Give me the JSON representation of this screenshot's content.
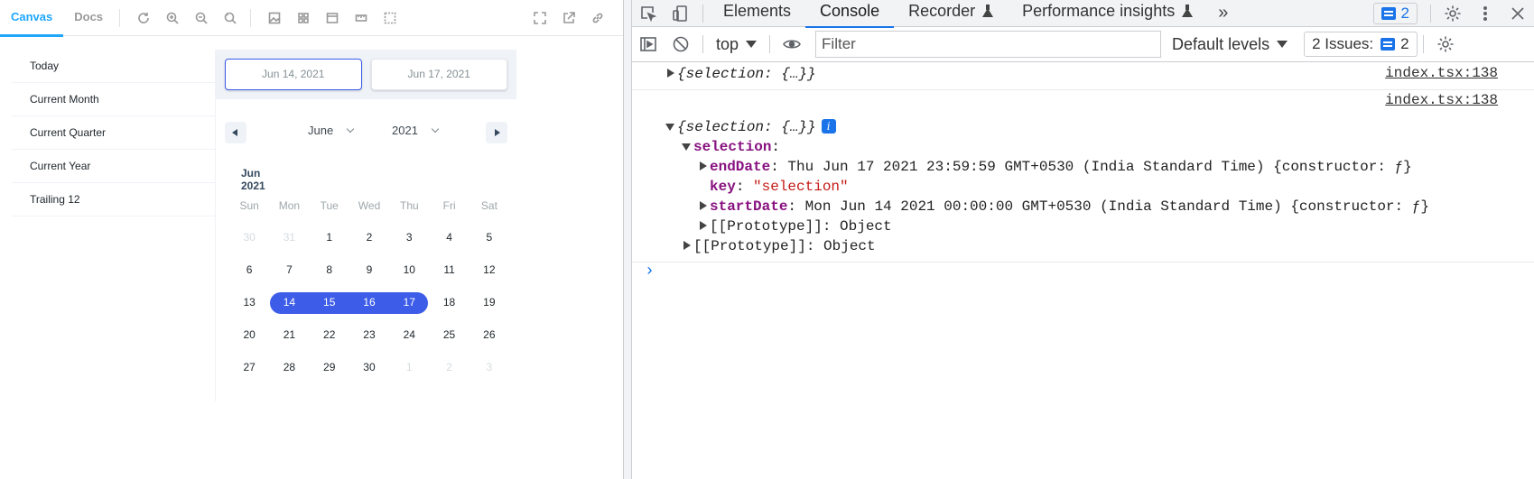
{
  "storybook": {
    "tabs": [
      "Canvas",
      "Docs"
    ],
    "active_tab": "Canvas"
  },
  "date_range_picker": {
    "static_ranges": [
      "Today",
      "Current Month",
      "Current Quarter",
      "Current Year",
      "Trailing 12"
    ],
    "start_date": "Jun 14, 2021",
    "end_date": "Jun 17, 2021",
    "month_picker": "June",
    "year_picker": "2021",
    "month_label": "Jun 2021",
    "weekdays": [
      "Sun",
      "Mon",
      "Tue",
      "Wed",
      "Thu",
      "Fri",
      "Sat"
    ],
    "weeks": [
      [
        "30",
        "31",
        "1",
        "2",
        "3",
        "4",
        "5"
      ],
      [
        "6",
        "7",
        "8",
        "9",
        "10",
        "11",
        "12"
      ],
      [
        "13",
        "14",
        "15",
        "16",
        "17",
        "18",
        "19"
      ],
      [
        "20",
        "21",
        "22",
        "23",
        "24",
        "25",
        "26"
      ],
      [
        "27",
        "28",
        "29",
        "30",
        "1",
        "2",
        "3"
      ]
    ],
    "passive_days": [
      [
        0,
        0
      ],
      [
        0,
        1
      ],
      [
        4,
        4
      ],
      [
        4,
        5
      ],
      [
        4,
        6
      ]
    ],
    "selected_range": {
      "week": 2,
      "from_index": 1,
      "to_index": 4
    },
    "accent_color": "#3d5ce8"
  },
  "devtools": {
    "tabs": [
      "Elements",
      "Console",
      "Recorder",
      "Performance insights"
    ],
    "active_tab": "Console",
    "more_tabs": "»",
    "message_count": "2",
    "context": "top",
    "filter_placeholder": "Filter",
    "levels": "Default levels",
    "issues_label": "2 Issues:",
    "issues_count": "2",
    "console": {
      "msg1": {
        "source": "index.tsx:138",
        "summary": "{selection: {…}}"
      },
      "msg2": {
        "source": "index.tsx:138",
        "summary": "{selection: {…}}",
        "selection_key": "selection",
        "endDate_key": "endDate",
        "endDate_value": "Thu Jun 17 2021 23:59:59 GMT+0530 (India Standard Time) {constructor: ƒ}",
        "key_key": "key",
        "key_value": "\"selection\"",
        "startDate_key": "startDate",
        "startDate_value": "Mon Jun 14 2021 00:00:00 GMT+0530 (India Standard Time) {constructor: ƒ}",
        "proto_inner": "[[Prototype]]: Object",
        "proto_outer": "[[Prototype]]: Object"
      },
      "prompt": "›"
    }
  }
}
